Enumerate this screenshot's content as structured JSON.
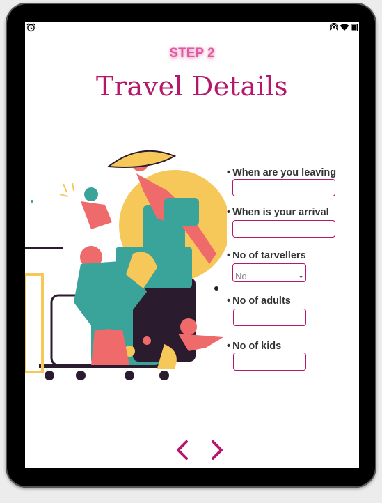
{
  "header": {
    "step": "STEP 2",
    "title": "Travel Details"
  },
  "form": {
    "leaving_label": "When are you leaving",
    "arrival_label": "When is your arrival",
    "travellers_label": "No of tarvellers",
    "travellers_selected": "No",
    "adults_label": "No of adults",
    "kids_label": "No of kids"
  },
  "icons": {
    "status_left": "alarm-icon",
    "status_right": [
      "hotspot-icon",
      "wifi-icon",
      "battery-icon"
    ],
    "prev": "chevron-left-icon",
    "next": "chevron-right-icon"
  },
  "colors": {
    "accent": "#b5176c",
    "step": "#e05aa0",
    "label": "#333333"
  }
}
